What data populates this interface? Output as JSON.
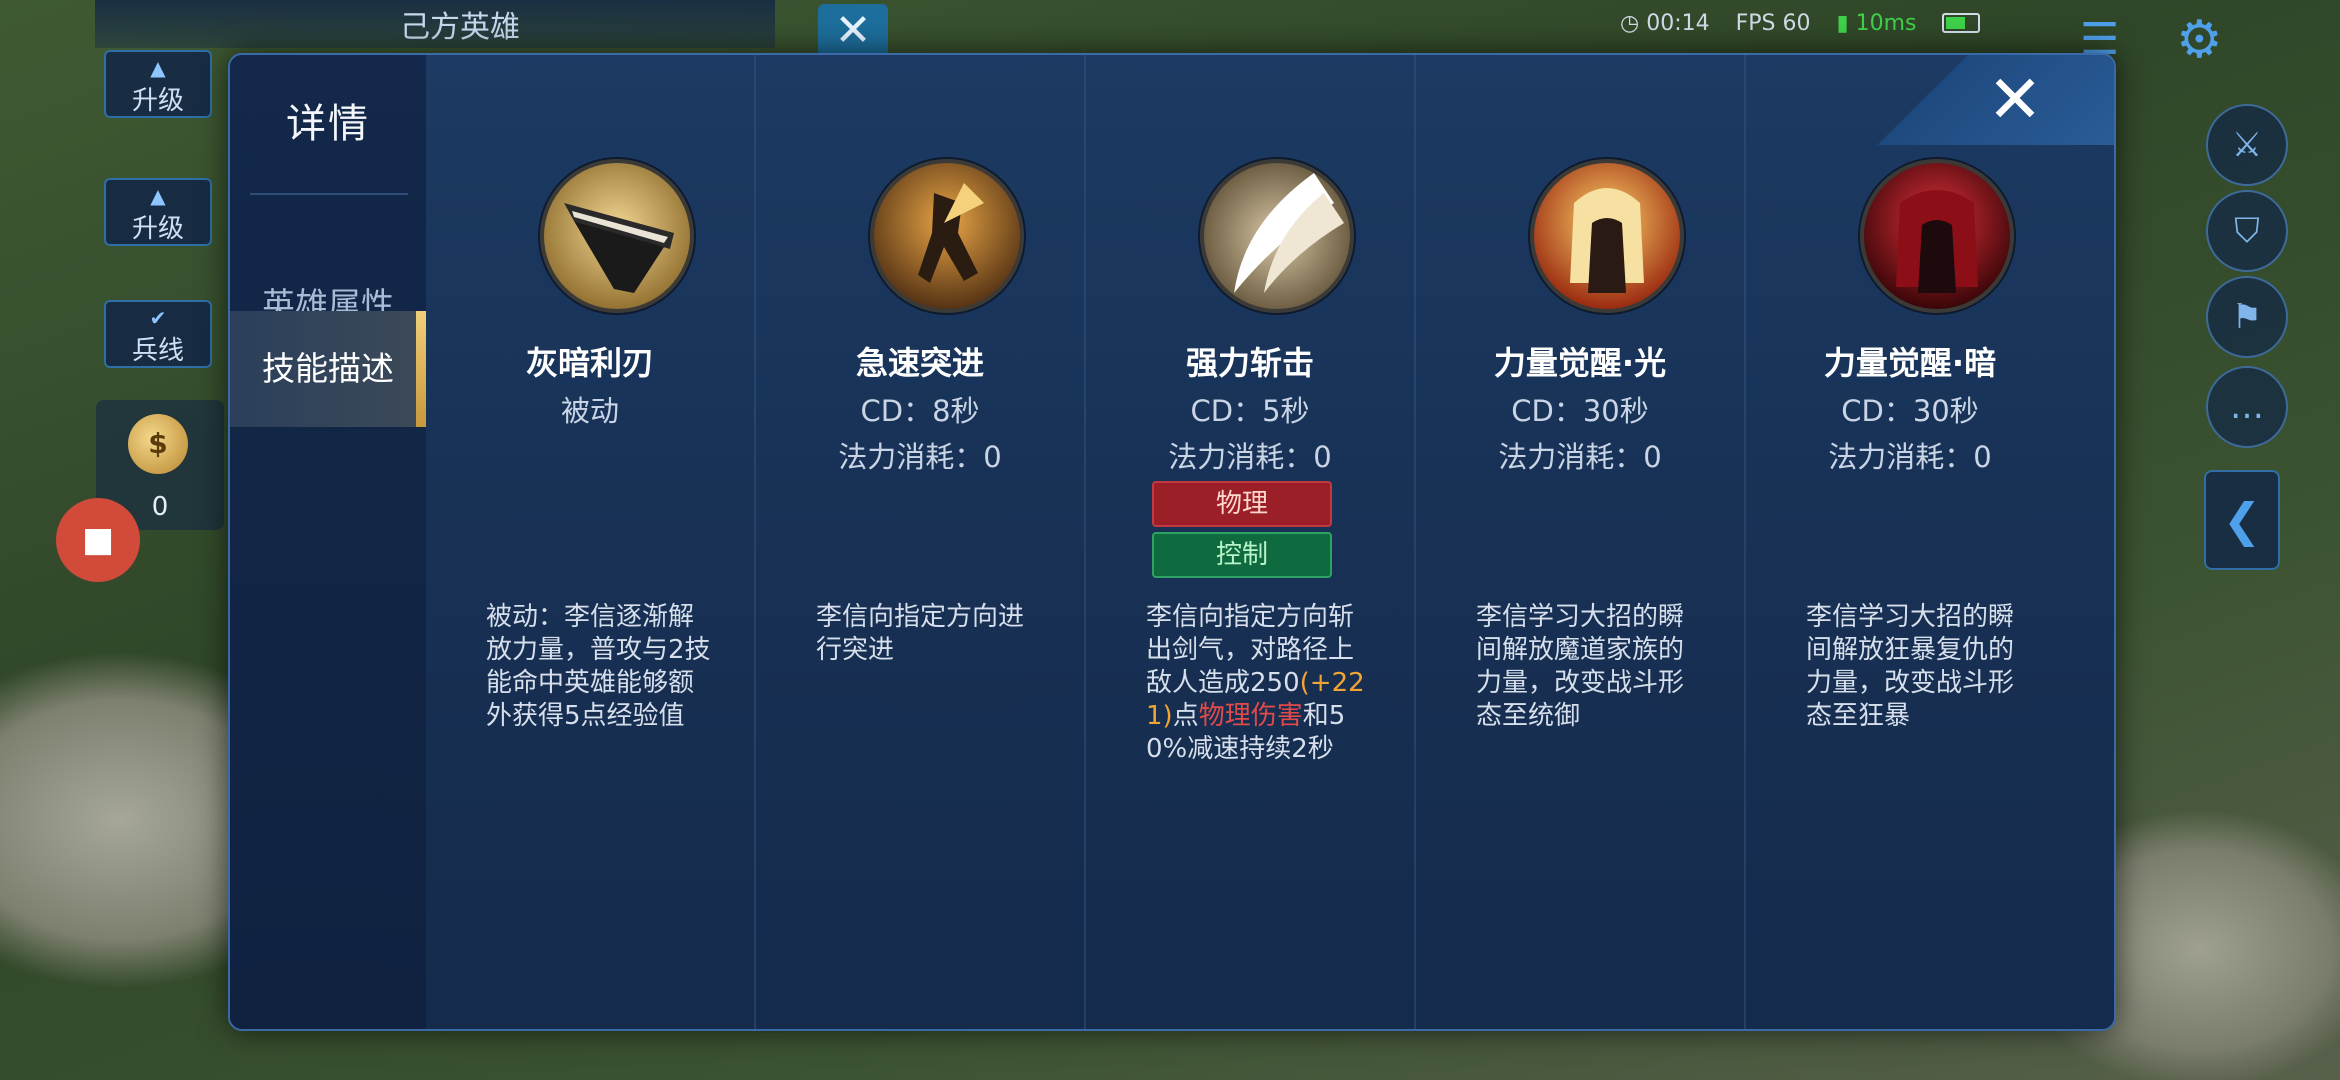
{
  "hud": {
    "ally_title": "己方英雄",
    "upgrade_label": "升级",
    "minion_label": "兵线",
    "gold": "0",
    "timer": "00:14",
    "fps": "FPS 60",
    "ping": "10ms"
  },
  "modal": {
    "heading": "详情",
    "tabs": [
      {
        "label": "英雄属性",
        "active": false
      },
      {
        "label": "技能描述",
        "active": true
      }
    ],
    "skills": [
      {
        "name": "灰暗利刃",
        "cd": "被动",
        "mana": "",
        "tags": [],
        "description": "被动：李信逐渐解放力量，普攻与2技能命中英雄能够额外获得5点经验值",
        "icon": "shadow-blade-icon"
      },
      {
        "name": "急速突进",
        "cd": "CD：8秒",
        "mana": "法力消耗：0",
        "tags": [],
        "description": "李信向指定方向进行突进",
        "icon": "dash-icon"
      },
      {
        "name": "强力斩击",
        "cd": "CD：5秒",
        "mana": "法力消耗：0",
        "tags": [
          "物理",
          "控制"
        ],
        "description_parts": [
          "李信向指定方向斩出剑气，对路径上敌人造成250",
          "(+221)",
          "点",
          "物理伤害",
          "和50%减速持续2秒"
        ],
        "icon": "slash-icon"
      },
      {
        "name": "力量觉醒·光",
        "cd": "CD：30秒",
        "mana": "法力消耗：0",
        "tags": [],
        "description": "李信学习大招的瞬间解放魔道家族的力量，改变战斗形态至统御",
        "icon": "awaken-light-icon"
      },
      {
        "name": "力量觉醒·暗",
        "cd": "CD：30秒",
        "mana": "法力消耗：0",
        "tags": [],
        "description": "李信学习大招的瞬间解放狂暴复仇的力量，改变战斗形态至狂暴",
        "icon": "awaken-dark-icon"
      }
    ]
  },
  "colors": {
    "panel": "#142a4d",
    "accent_gold": "#e0b860",
    "tag_physical": "#9b1f27",
    "tag_control": "#0f6b3f",
    "highlight_orange": "#f3a533",
    "highlight_red": "#e24a4a"
  }
}
